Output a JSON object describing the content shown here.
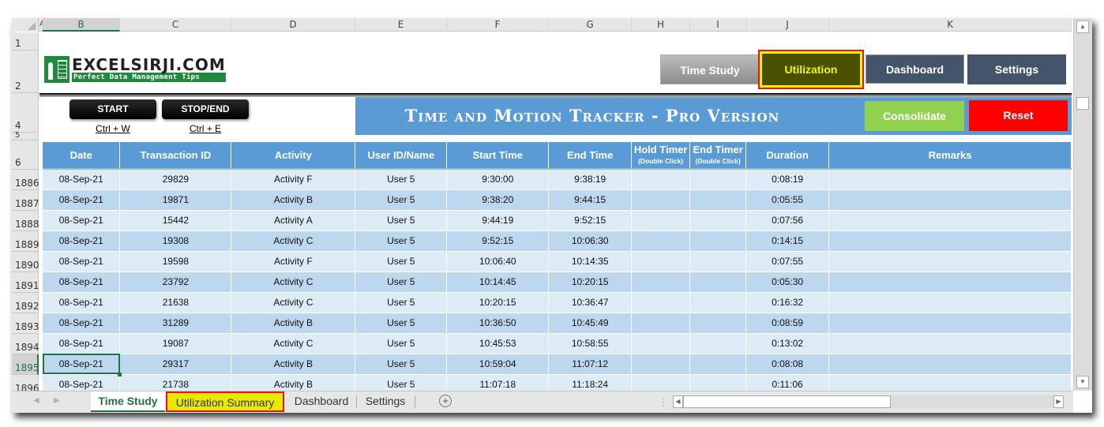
{
  "columns": [
    "A",
    "B",
    "C",
    "D",
    "E",
    "F",
    "G",
    "H",
    "I",
    "J",
    "K"
  ],
  "active_column": "B",
  "top_row_numbers": [
    "1",
    "2",
    "4",
    "5",
    "6"
  ],
  "logo": {
    "title": "EXCELSIRJI.COM",
    "tagline": "Perfect Data Management Tips"
  },
  "nav": {
    "time_study": "Time Study",
    "utilization": "Utilization",
    "dashboard": "Dashboard",
    "settings": "Settings"
  },
  "controls": {
    "start": "START",
    "start_shortcut": "Ctrl + W",
    "stop": "STOP/END",
    "stop_shortcut": "Ctrl + E"
  },
  "banner": {
    "title": "Time and Motion Tracker - Pro Version",
    "consolidate": "Consolidate",
    "reset": "Reset"
  },
  "table": {
    "headers": [
      {
        "label": "Date"
      },
      {
        "label": "Transaction ID"
      },
      {
        "label": "Activity"
      },
      {
        "label": "User ID/Name"
      },
      {
        "label": "Start Time"
      },
      {
        "label": "End Time"
      },
      {
        "label": "Hold Timer",
        "sub": "(Double Click)"
      },
      {
        "label": "End Timer",
        "sub": "(Double Click)"
      },
      {
        "label": "Duration"
      },
      {
        "label": "Remarks"
      }
    ],
    "rows": [
      {
        "row": "1886",
        "date": "08-Sep-21",
        "id": "29829",
        "activity": "Activity F",
        "user": "User 5",
        "start": "9:30:00",
        "end": "9:38:19",
        "hold": "",
        "endtimer": "",
        "duration": "0:08:19",
        "remarks": ""
      },
      {
        "row": "1887",
        "date": "08-Sep-21",
        "id": "19871",
        "activity": "Activity B",
        "user": "User 5",
        "start": "9:38:20",
        "end": "9:44:15",
        "hold": "",
        "endtimer": "",
        "duration": "0:05:55",
        "remarks": ""
      },
      {
        "row": "1888",
        "date": "08-Sep-21",
        "id": "15442",
        "activity": "Activity A",
        "user": "User 5",
        "start": "9:44:19",
        "end": "9:52:15",
        "hold": "",
        "endtimer": "",
        "duration": "0:07:56",
        "remarks": ""
      },
      {
        "row": "1889",
        "date": "08-Sep-21",
        "id": "19308",
        "activity": "Activity C",
        "user": "User 5",
        "start": "9:52:15",
        "end": "10:06:30",
        "hold": "",
        "endtimer": "",
        "duration": "0:14:15",
        "remarks": ""
      },
      {
        "row": "1890",
        "date": "08-Sep-21",
        "id": "19598",
        "activity": "Activity F",
        "user": "User 5",
        "start": "10:06:40",
        "end": "10:14:35",
        "hold": "",
        "endtimer": "",
        "duration": "0:07:55",
        "remarks": ""
      },
      {
        "row": "1891",
        "date": "08-Sep-21",
        "id": "23792",
        "activity": "Activity C",
        "user": "User 5",
        "start": "10:14:45",
        "end": "10:20:15",
        "hold": "",
        "endtimer": "",
        "duration": "0:05:30",
        "remarks": ""
      },
      {
        "row": "1892",
        "date": "08-Sep-21",
        "id": "21638",
        "activity": "Activity C",
        "user": "User 5",
        "start": "10:20:15",
        "end": "10:36:47",
        "hold": "",
        "endtimer": "",
        "duration": "0:16:32",
        "remarks": ""
      },
      {
        "row": "1893",
        "date": "08-Sep-21",
        "id": "31289",
        "activity": "Activity B",
        "user": "User 5",
        "start": "10:36:50",
        "end": "10:45:49",
        "hold": "",
        "endtimer": "",
        "duration": "0:08:59",
        "remarks": ""
      },
      {
        "row": "1894",
        "date": "08-Sep-21",
        "id": "19087",
        "activity": "Activity C",
        "user": "User 5",
        "start": "10:45:53",
        "end": "10:58:55",
        "hold": "",
        "endtimer": "",
        "duration": "0:13:02",
        "remarks": ""
      },
      {
        "row": "1895",
        "date": "08-Sep-21",
        "id": "29317",
        "activity": "Activity B",
        "user": "User 5",
        "start": "10:59:04",
        "end": "11:07:12",
        "hold": "",
        "endtimer": "",
        "duration": "0:08:08",
        "remarks": ""
      },
      {
        "row": "1896",
        "date": "08-Sep-21",
        "id": "21738",
        "activity": "Activity B",
        "user": "User 5",
        "start": "11:07:18",
        "end": "11:18:24",
        "hold": "",
        "endtimer": "",
        "duration": "0:11:06",
        "remarks": ""
      }
    ],
    "selected_row": "1895"
  },
  "sheet_tabs": [
    {
      "label": "Time Study",
      "state": "active"
    },
    {
      "label": "Utilization Summary",
      "state": "highlighted"
    },
    {
      "label": "Dashboard",
      "state": "normal"
    },
    {
      "label": "Settings",
      "state": "normal"
    }
  ],
  "icons": {
    "add_sheet": "+",
    "scroll_up": "▲",
    "scroll_down": "▼",
    "scroll_left": "◀",
    "scroll_right": "▶",
    "tab_prev": "◀",
    "tab_next": "▶"
  },
  "colors": {
    "header_blue": "#5b9bd5",
    "row_light": "#ddebf7",
    "row_dark": "#bdd7ee",
    "excel_green": "#217346",
    "reset_red": "#ff0000",
    "consolidate_green": "#92d050"
  }
}
